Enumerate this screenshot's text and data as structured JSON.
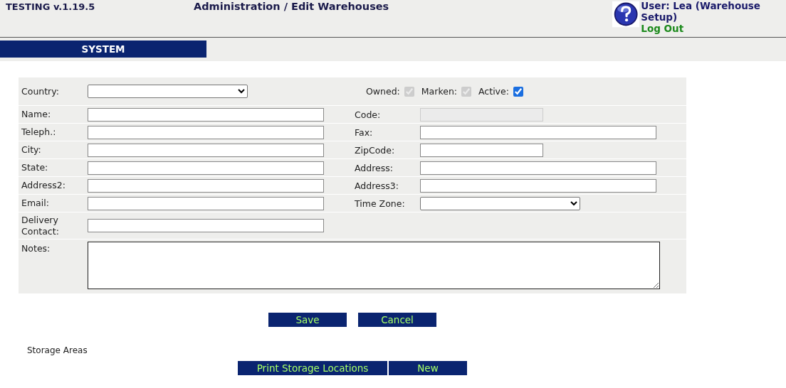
{
  "header": {
    "version": "TESTING v.1.19.5",
    "title": "Administration / Edit Warehouses",
    "user": "User: Lea (Warehouse Setup)",
    "logout": "Log Out"
  },
  "nav": [
    {
      "label": "SYSTEM",
      "selected": true
    }
  ],
  "form": {
    "country": {
      "label": "Country:",
      "kind": "select"
    },
    "checkboxes": [
      {
        "label": "Owned:",
        "checked": true,
        "disabled": true
      },
      {
        "label": "Marken:",
        "checked": true,
        "disabled": true
      },
      {
        "label": "Active:",
        "checked": true,
        "disabled": false
      }
    ],
    "rows": [
      {
        "left": {
          "label": "Name:",
          "kind": "text"
        },
        "right": {
          "label": "Code:",
          "kind": "disabled"
        }
      },
      {
        "left": {
          "label": "Teleph.:",
          "kind": "text"
        },
        "right": {
          "label": "Fax:",
          "kind": "text"
        }
      },
      {
        "left": {
          "label": "City:",
          "kind": "text"
        },
        "right": {
          "label": "ZipCode:",
          "kind": "short"
        }
      },
      {
        "left": {
          "label": "State:",
          "kind": "text"
        },
        "right": {
          "label": "Address:",
          "kind": "text"
        }
      },
      {
        "left": {
          "label": "Address2:",
          "kind": "text"
        },
        "right": {
          "label": "Address3:",
          "kind": "text"
        }
      },
      {
        "left": {
          "label": "Email:",
          "kind": "text"
        },
        "right": {
          "label": "Time Zone:",
          "kind": "select"
        }
      },
      {
        "left": {
          "label": "Delivery Contact:",
          "kind": "text"
        }
      }
    ],
    "notes": {
      "label": "Notes:"
    }
  },
  "buttons": [
    "Save",
    "Cancel"
  ],
  "storage": {
    "title": "Storage Areas",
    "buttons": [
      "Print Storage Locations",
      "New"
    ]
  }
}
